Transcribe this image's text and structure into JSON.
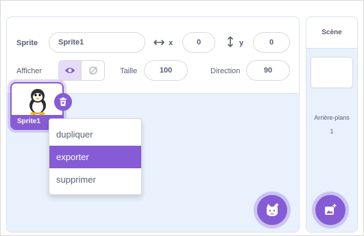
{
  "sprite_info": {
    "sprite_label": "Sprite",
    "sprite_name": "Sprite1",
    "x_label": "x",
    "x_value": "0",
    "y_label": "y",
    "y_value": "0",
    "show_label": "Afficher",
    "size_label": "Taille",
    "size_value": "100",
    "direction_label": "Direction",
    "direction_value": "90"
  },
  "sprite_tile": {
    "name": "Sprite1",
    "icon": "penguin-icon"
  },
  "context_menu": {
    "items": [
      {
        "label": "dupliquer"
      },
      {
        "label": "exporter"
      },
      {
        "label": "supprimer"
      }
    ],
    "active_index": 1
  },
  "stage": {
    "title": "Scène",
    "backdrops_label": "Arrière-plans",
    "backdrops_count": "1"
  },
  "colors": {
    "accent": "#855cd6",
    "pane_bg": "#e9f1fc",
    "text": "#575e75",
    "toggle_on_bg": "#e6dcfa"
  }
}
